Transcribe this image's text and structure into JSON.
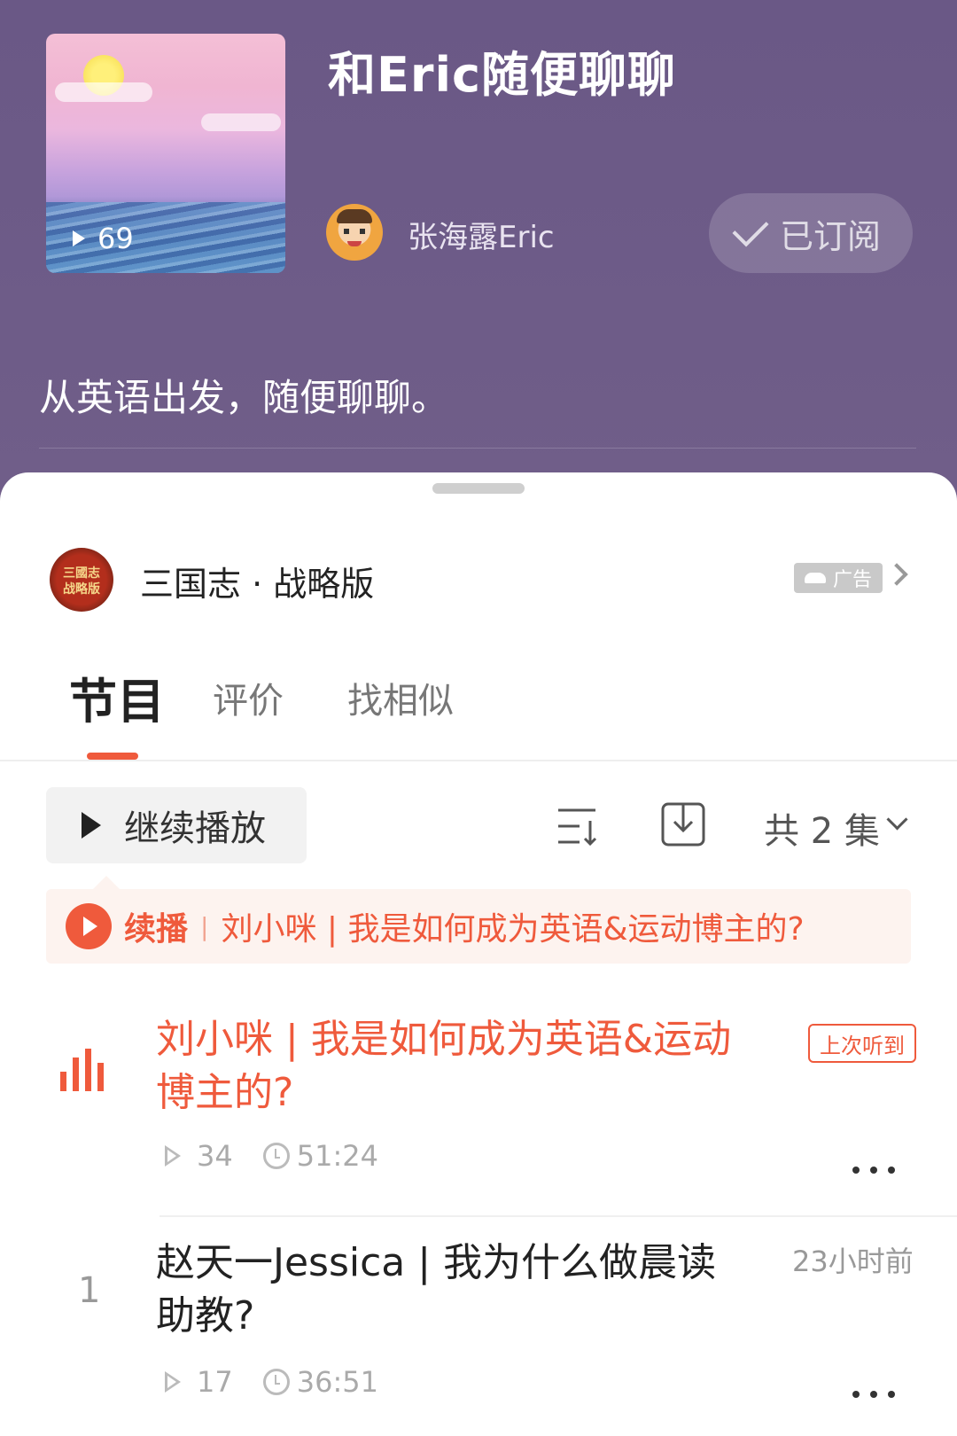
{
  "podcast": {
    "title": "和Eric随便聊聊",
    "cover_play_count": "69",
    "author_name": "张海露Eric",
    "subscribe_label": "已订阅",
    "description": "从英语出发，随便聊聊。"
  },
  "ad": {
    "logo_text": "三國志 战略版",
    "name": "三国志 · 战略版",
    "badge": "广告"
  },
  "tabs": {
    "episodes": "节目",
    "reviews": "评价",
    "similar": "找相似"
  },
  "controls": {
    "continue_label": "继续播放",
    "episode_count": "共 2 集"
  },
  "resume": {
    "label": "续播",
    "title": "刘小咪 | 我是如何成为英语&运动博主的?"
  },
  "episodes": [
    {
      "title": "刘小咪 | 我是如何成为英语&运动博主的?",
      "badge": "上次听到",
      "plays": "34",
      "duration": "51:24"
    },
    {
      "index": "1",
      "title": "赵天一Jessica | 我为什么做晨读助教?",
      "time_ago": "23小时前",
      "plays": "17",
      "duration": "36:51"
    }
  ],
  "colors": {
    "accent": "#ef5a3c",
    "header_bg": "#6c5a86"
  },
  "icons": [
    "play-icon",
    "check-icon",
    "chevron-right-icon",
    "sort-icon",
    "download-icon",
    "chevron-down-icon",
    "equalizer-icon",
    "clock-icon",
    "more-icon"
  ]
}
